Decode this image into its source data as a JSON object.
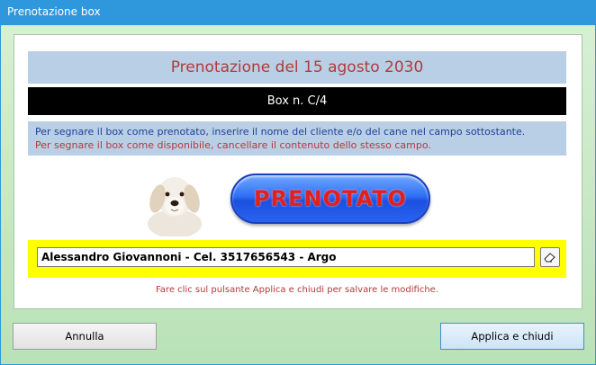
{
  "window": {
    "title": "Prenotazione box"
  },
  "header": {
    "title": "Prenotazione del 15 agosto 2030",
    "box_label": "Box n. C/4"
  },
  "info": {
    "line1": "Per segnare il box come prenotato, inserire il nome del cliente e/o del cane nel campo sottostante.",
    "line2": "Per segnare il box come disponibile, cancellare il contenuto dello stesso campo."
  },
  "status": {
    "label": "PRENOTATO",
    "image": "dog-image"
  },
  "client_field": {
    "value": "Alessandro Giovannoni - Cel. 3517656543 - Argo",
    "clear_icon": "eraser-icon"
  },
  "hint": "Fare clic sul pulsante Applica e chiudi per salvare le modifiche.",
  "buttons": {
    "cancel": "Annulla",
    "apply": "Applica e chiudi"
  },
  "colors": {
    "titlebar": "#2f97dc",
    "header_bg": "#b9cfe5",
    "header_text": "#b23a3a",
    "field_highlight": "#ffff00",
    "status_button": "#2f6ff5",
    "status_text": "#e02020"
  }
}
